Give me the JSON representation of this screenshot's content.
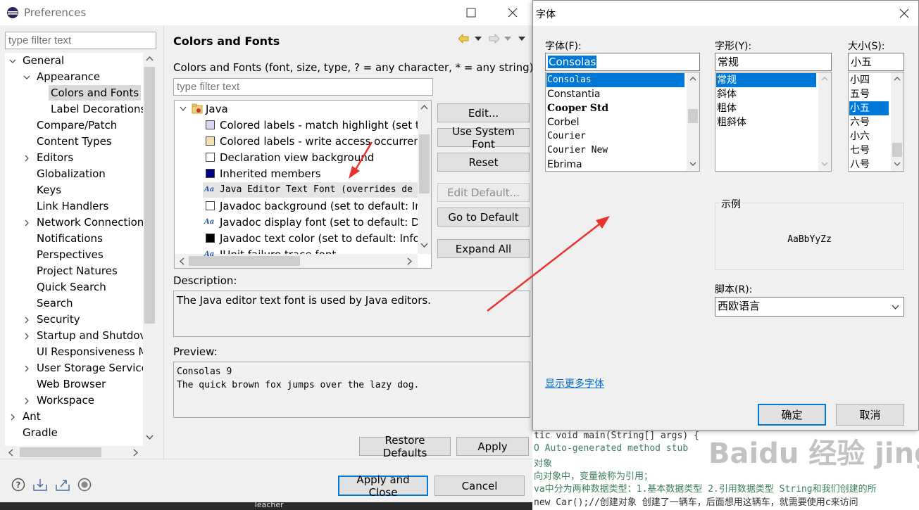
{
  "preferences": {
    "title": "Preferences",
    "filter_placeholder": "type filter text",
    "tree": [
      {
        "label": "General",
        "level": 0,
        "state": "open"
      },
      {
        "label": "Appearance",
        "level": 1,
        "state": "open"
      },
      {
        "label": "Colors and Fonts",
        "level": 2,
        "state": "leaf",
        "selected": true
      },
      {
        "label": "Label Decorations",
        "level": 2,
        "state": "leaf"
      },
      {
        "label": "Compare/Patch",
        "level": 1,
        "state": "leaf"
      },
      {
        "label": "Content Types",
        "level": 1,
        "state": "leaf"
      },
      {
        "label": "Editors",
        "level": 1,
        "state": "closed"
      },
      {
        "label": "Globalization",
        "level": 1,
        "state": "leaf"
      },
      {
        "label": "Keys",
        "level": 1,
        "state": "leaf"
      },
      {
        "label": "Link Handlers",
        "level": 1,
        "state": "leaf"
      },
      {
        "label": "Network Connection",
        "level": 1,
        "state": "closed"
      },
      {
        "label": "Notifications",
        "level": 1,
        "state": "leaf"
      },
      {
        "label": "Perspectives",
        "level": 1,
        "state": "leaf"
      },
      {
        "label": "Project Natures",
        "level": 1,
        "state": "leaf"
      },
      {
        "label": "Quick Search",
        "level": 1,
        "state": "leaf"
      },
      {
        "label": "Search",
        "level": 1,
        "state": "leaf"
      },
      {
        "label": "Security",
        "level": 1,
        "state": "closed"
      },
      {
        "label": "Startup and Shutdov",
        "level": 1,
        "state": "closed"
      },
      {
        "label": "UI Responsiveness M",
        "level": 1,
        "state": "leaf"
      },
      {
        "label": "User Storage Service",
        "level": 1,
        "state": "closed"
      },
      {
        "label": "Web Browser",
        "level": 1,
        "state": "leaf"
      },
      {
        "label": "Workspace",
        "level": 1,
        "state": "closed"
      },
      {
        "label": "Ant",
        "level": 0,
        "state": "closed"
      },
      {
        "label": "Gradle",
        "level": 0,
        "state": "leaf"
      }
    ],
    "page_title": "Colors and Fonts",
    "page_desc": "Colors and Fonts (font, size, type, ? = any character, * = any string) :",
    "cf_filter_placeholder": "type filter text",
    "cf_root": "Java",
    "cf_items": [
      {
        "label": "Colored labels - match highlight (set to",
        "kind": "color",
        "color": "#d6d6f5"
      },
      {
        "label": "Colored labels - write access occurrenc",
        "kind": "color",
        "color": "#f2dfb3"
      },
      {
        "label": "Declaration view background",
        "kind": "color",
        "color": "#ffffff"
      },
      {
        "label": "Inherited members",
        "kind": "color",
        "color": "#000080"
      },
      {
        "label": "Java Editor Text Font (overrides de",
        "kind": "font",
        "mono": true,
        "highlighted": true
      },
      {
        "label": "Javadoc background (set to default: Inf",
        "kind": "color",
        "color": "#ffffff"
      },
      {
        "label": "Javadoc display font (set to default: Dia",
        "kind": "font"
      },
      {
        "label": "Javadoc text color (set to default: Infor",
        "kind": "color",
        "color": "#000000"
      },
      {
        "label": "JUnit failure trace font",
        "kind": "font"
      }
    ],
    "buttons": {
      "edit": "Edit...",
      "use_system_font": "Use System Font",
      "reset": "Reset",
      "edit_default": "Edit Default...",
      "go_to_default": "Go to Default",
      "expand_all": "Expand All",
      "restore_defaults": "Restore Defaults",
      "apply": "Apply",
      "apply_and_close": "Apply and Close",
      "cancel": "Cancel"
    },
    "description_label": "Description:",
    "description_text": "The Java editor text font is used by Java editors.",
    "preview_label": "Preview:",
    "preview_lines": [
      "Consolas 9",
      "The quick brown fox jumps over the lazy dog."
    ]
  },
  "font_dialog": {
    "title": "字体",
    "font_label": "字体(F):",
    "style_label": "字形(Y):",
    "size_label": "大小(S):",
    "font_value": "Consolas",
    "style_value": "常规",
    "size_value": "小五",
    "fonts": [
      "Consolas",
      "Constantia",
      "Cooper Std",
      "Corbel",
      "Courier",
      "Courier New",
      "Ebrima"
    ],
    "styles": [
      "常规",
      "斜体",
      "粗体",
      "粗斜体"
    ],
    "sizes": [
      "小四",
      "五号",
      "小五",
      "六号",
      "小六",
      "七号",
      "八号"
    ],
    "sample_label": "示例",
    "sample_text": "AaBbYyZz",
    "script_label": "脚本(R):",
    "script_value": "西欧语言",
    "more_fonts_link": "显示更多字体",
    "ok": "确定",
    "cancel": "取消"
  },
  "code_lines": [
    "tic void main(String[] args) {",
    "O Auto-generated method stub",
    "对象",
    "向对象中，变量被称为引用；",
    "va中分为两种数据类型：1.基本数据类型  2.引用数据类型  String和我们创建的所",
    "new Car();//创建对象 创建了一辆车，后面想用这辆车，就需要使用c来访问"
  ],
  "taskbar_item": "Teacher",
  "watermark": "Baidu 经验  jingyan.baidu.com",
  "colors": {
    "selection": "#0078d7",
    "arrow": "#e8322f",
    "link": "#0066cc"
  }
}
